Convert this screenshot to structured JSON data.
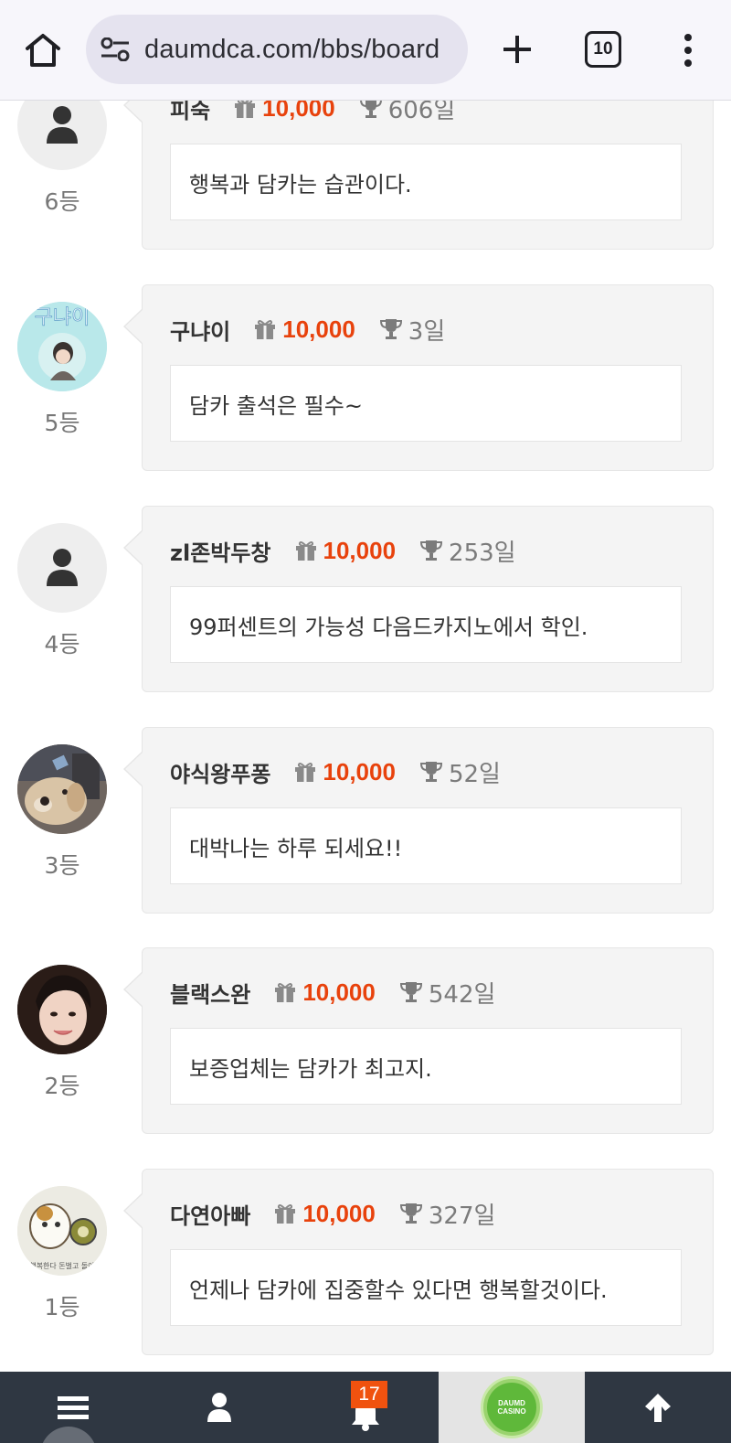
{
  "browser": {
    "url": "daumdca.com/bbs/board",
    "tab_count": "10",
    "icons": {
      "home": "home-icon",
      "site_settings": "tune-icon",
      "new_tab": "plus-icon",
      "tabs": "tab-switcher-icon",
      "menu": "more-vert-icon"
    }
  },
  "ranking": {
    "accent_color": "#e8420c",
    "items": [
      {
        "rank": "6등",
        "nickname": "피숙",
        "points": "10,000",
        "days": "606일",
        "comment": "행복과 담카는 습관이다.",
        "avatar": "default-user"
      },
      {
        "rank": "5등",
        "nickname": "구냐이",
        "points": "10,000",
        "days": "3일",
        "comment": "담카 출석은 필수~",
        "avatar": "character-illustration",
        "avatar_text": "구냐이"
      },
      {
        "rank": "4등",
        "nickname": "zl존박두창",
        "points": "10,000",
        "days": "253일",
        "comment": "99퍼센트의 가능성 다음드카지노에서 학인.",
        "avatar": "default-user"
      },
      {
        "rank": "3등",
        "nickname": "야식왕푸퐁",
        "points": "10,000",
        "days": "52일",
        "comment": "대박나는 하루 되세요!!",
        "avatar": "dog-photo"
      },
      {
        "rank": "2등",
        "nickname": "블랙스완",
        "points": "10,000",
        "days": "542일",
        "comment": "보증업체는 담카가 최고지.",
        "avatar": "portrait-photo"
      },
      {
        "rank": "1등",
        "nickname": "다연아빠",
        "points": "10,000",
        "days": "327일",
        "comment": "언제나 담카에 집중할수 있다면 행복할것이다.",
        "avatar": "hamster-drawing",
        "avatar_text": "행복한다 돈벌고 돌아"
      }
    ]
  },
  "bottom_nav": {
    "notification_count": "17",
    "logo_text": [
      "DAUMD",
      "CASINO"
    ],
    "icons": [
      "hamburger-icon",
      "user-icon",
      "bell-icon",
      "logo",
      "arrow-up-icon"
    ]
  }
}
